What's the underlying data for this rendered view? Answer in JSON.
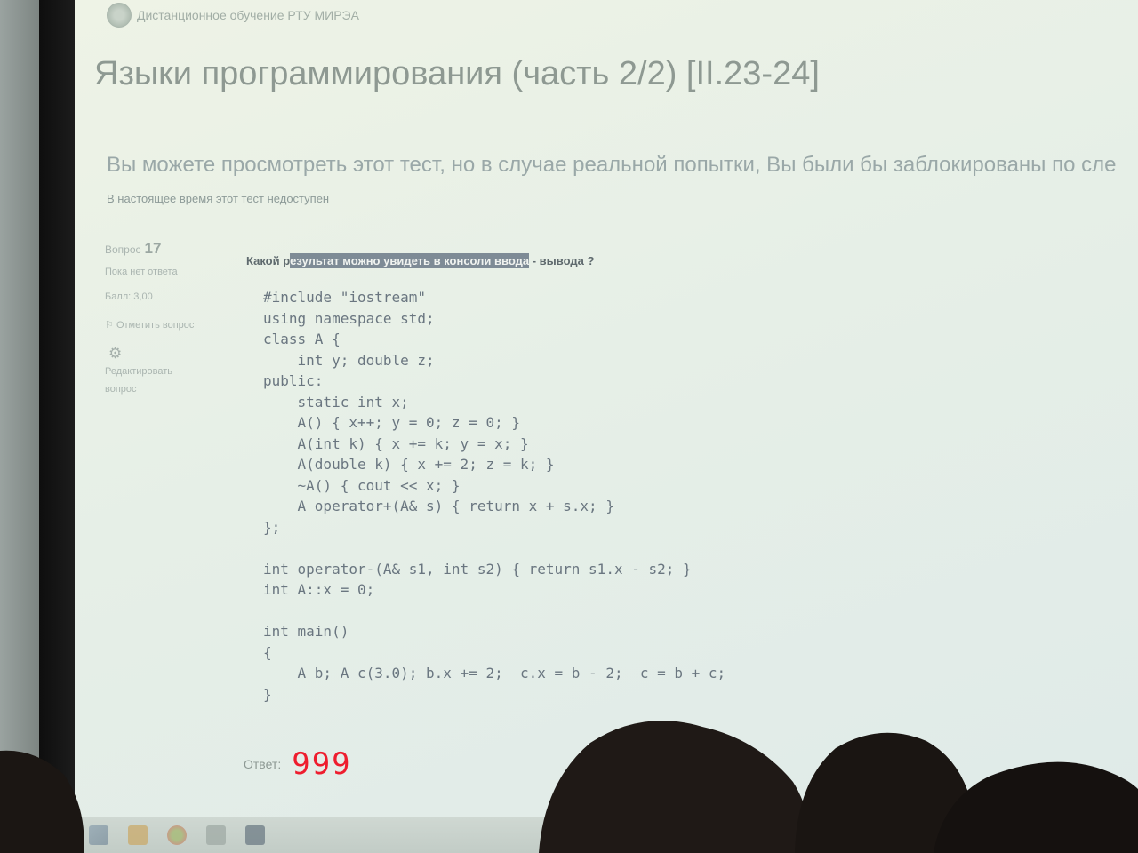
{
  "site": {
    "name": "Дистанционное обучение РТУ МИРЭА",
    "logo_icon": "university-emblem-icon"
  },
  "course": {
    "title": "Языки программирования (часть 2/2) [II.23-24]"
  },
  "notice": {
    "preview_warning": "Вы можете просмотреть этот тест, но в случае реальной попытки, Вы были бы заблокированы по сле",
    "unavailable": "В настоящее время этот тест недоступен"
  },
  "question_info": {
    "label": "Вопрос",
    "number": "17",
    "status": "Пока нет ответа",
    "points": "Балл: 3,00",
    "flag_label": "Отметить вопрос",
    "flag_icon": "flag-icon",
    "edit_label": "Редактировать вопрос",
    "edit_icon": "gear-icon"
  },
  "question": {
    "pre": "Какой р",
    "highlighted": "езультат можно увидеть в консоли ввода",
    "post": " - вывода ?"
  },
  "code_lines": [
    "#include \"iostream\"",
    "using namespace std;",
    "class A {",
    "    int y; double z;",
    "public:",
    "    static int x;",
    "    A() { x++; y = 0; z = 0; }",
    "    A(int k) { x += k; y = x; }",
    "    A(double k) { x += 2; z = k; }",
    "    ~A() { cout << x; }",
    "    A operator+(A& s) { return x + s.x; }",
    "};",
    "",
    "int operator-(A& s1, int s2) { return s1.x - s2; }",
    "int A::x = 0;",
    "",
    "int main()",
    "{",
    "    A b; A c(3.0); b.x += 2;  c.x = b - 2;  c = b + c;",
    "}"
  ],
  "answer": {
    "label": "Ответ:",
    "value": "999"
  },
  "taskbar": [
    {
      "icon": "windows-start-icon"
    },
    {
      "icon": "file-explorer-icon"
    },
    {
      "icon": "chrome-icon"
    },
    {
      "icon": "document-icon"
    },
    {
      "icon": "app-icon"
    }
  ],
  "colors": {
    "screen_bg": "#e6efe7",
    "highlight": "#7e8b96",
    "answer_red": "#ee1d2e"
  }
}
